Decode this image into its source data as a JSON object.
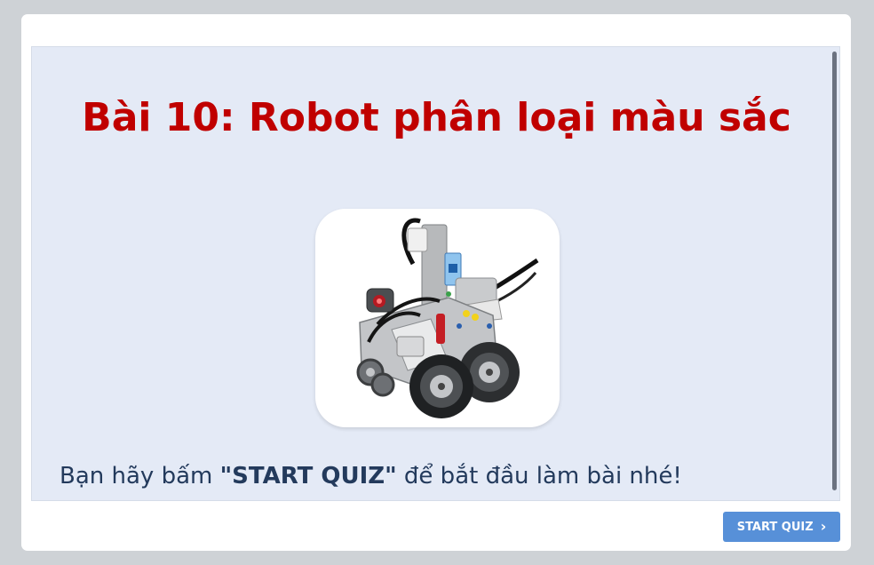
{
  "slide": {
    "title": "Bài 10: Robot phân loại màu sắc",
    "instruction_prefix": "Bạn hãy bấm ",
    "instruction_bold": "\"START QUIZ\"",
    "instruction_suffix": " để bắt đầu làm bài nhé!"
  },
  "image": {
    "subject": "lego-ev3-color-sorter-robot"
  },
  "footer": {
    "start_label": "START QUIZ",
    "start_icon": "chevron-right-icon"
  },
  "colors": {
    "title": "#c00000",
    "button": "#5790d8",
    "slide_bg": "#e4eaf6",
    "text": "#233a5c"
  }
}
